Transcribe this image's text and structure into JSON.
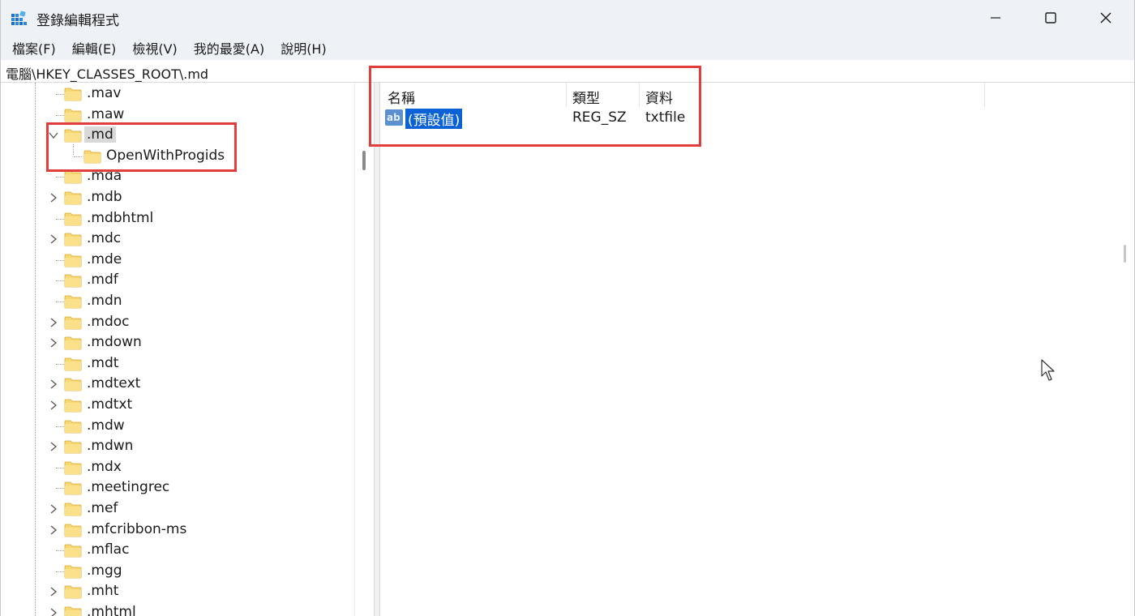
{
  "window": {
    "title": "登錄編輯程式",
    "app_icon": "registry-editor-icon",
    "controls": {
      "minimize": "minimize-icon",
      "maximize": "maximize-icon",
      "close": "close-icon"
    }
  },
  "menubar": {
    "items": [
      "檔案(F)",
      "編輯(E)",
      "檢視(V)",
      "我的最愛(A)",
      "說明(H)"
    ]
  },
  "address": {
    "path": "電腦\\HKEY_CLASSES_ROOT\\.md"
  },
  "tree": {
    "items": [
      {
        "label": ".mav",
        "expandable": false
      },
      {
        "label": ".maw",
        "expandable": false
      },
      {
        "label": ".md",
        "expandable": true,
        "expanded": true,
        "selected": true
      },
      {
        "label": "OpenWithProgids",
        "expandable": false,
        "child": true
      },
      {
        "label": ".mda",
        "expandable": false
      },
      {
        "label": ".mdb",
        "expandable": true
      },
      {
        "label": ".mdbhtml",
        "expandable": false
      },
      {
        "label": ".mdc",
        "expandable": true
      },
      {
        "label": ".mde",
        "expandable": false
      },
      {
        "label": ".mdf",
        "expandable": false
      },
      {
        "label": ".mdn",
        "expandable": false
      },
      {
        "label": ".mdoc",
        "expandable": true
      },
      {
        "label": ".mdown",
        "expandable": true
      },
      {
        "label": ".mdt",
        "expandable": false
      },
      {
        "label": ".mdtext",
        "expandable": true
      },
      {
        "label": ".mdtxt",
        "expandable": true
      },
      {
        "label": ".mdw",
        "expandable": false
      },
      {
        "label": ".mdwn",
        "expandable": true
      },
      {
        "label": ".mdx",
        "expandable": false
      },
      {
        "label": ".meetingrec",
        "expandable": false
      },
      {
        "label": ".mef",
        "expandable": true
      },
      {
        "label": ".mfcribbon-ms",
        "expandable": true
      },
      {
        "label": ".mflac",
        "expandable": false
      },
      {
        "label": ".mgg",
        "expandable": false
      },
      {
        "label": ".mht",
        "expandable": true
      },
      {
        "label": ".mhtml",
        "expandable": true
      }
    ]
  },
  "list": {
    "columns": {
      "name": "名稱",
      "type": "類型",
      "data": "資料"
    },
    "rows": [
      {
        "name": "(預設值)",
        "type": "REG_SZ",
        "data": "txtfile",
        "icon": "string-value-icon",
        "selected": true
      }
    ]
  },
  "colors": {
    "annotation": "#e23d3d",
    "selection": "#0b62d6",
    "folder": "#f8d775",
    "titlebar": "#eef2f6"
  }
}
